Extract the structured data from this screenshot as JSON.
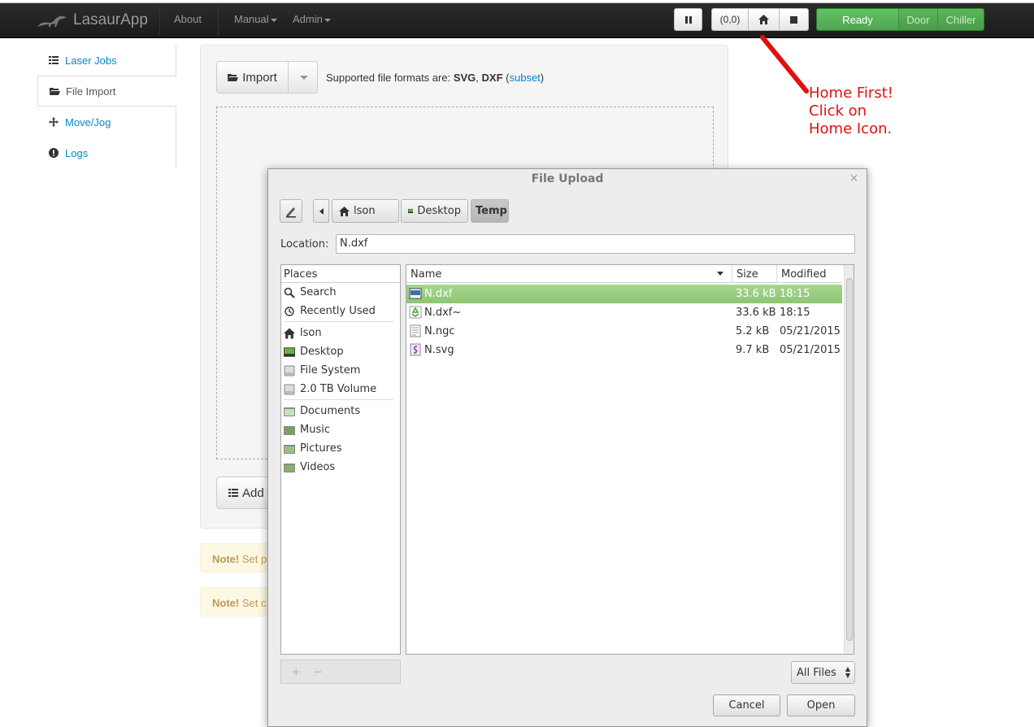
{
  "navbar": {
    "brand": "LasaurApp",
    "about": "About",
    "manual": "Manual",
    "admin": "Admin",
    "position_label": "(0,0)",
    "status_ready": "Ready",
    "status_door": "Door",
    "status_chiller": "Chiller"
  },
  "sidebar": {
    "items": [
      {
        "label": "Laser Jobs",
        "icon": "list-icon"
      },
      {
        "label": "File Import",
        "icon": "folder-open-icon"
      },
      {
        "label": "Move/Jog",
        "icon": "move-icon"
      },
      {
        "label": "Logs",
        "icon": "alert-circle-icon"
      }
    ]
  },
  "main": {
    "import_label": "Import",
    "supported_prefix": "Supported file formats are:",
    "fmt_svg": "SVG",
    "fmt_dxf": "DXF",
    "subset_link": "subset",
    "add_label": "Add",
    "note1_bold": "Note!",
    "note1_text": "Set p",
    "note2_bold": "Note!",
    "note2_text": "Set c"
  },
  "annotation": {
    "line1": "Home First!",
    "line2": "Click on",
    "line3": "Home Icon.",
    "color": "#e01010"
  },
  "dialog": {
    "title": "File Upload",
    "close": "×",
    "breadcrumbs": [
      "lson",
      "Desktop",
      "Temp"
    ],
    "location_label": "Location:",
    "location_value": "N.dxf",
    "places_header": "Places",
    "places": [
      {
        "label": "Search",
        "icon": "search-icon"
      },
      {
        "label": "Recently Used",
        "icon": "recent-icon"
      },
      {
        "label": "lson",
        "icon": "home-icon"
      },
      {
        "label": "Desktop",
        "icon": "desktop-icon"
      },
      {
        "label": "File System",
        "icon": "drive-icon"
      },
      {
        "label": "2.0 TB Volume",
        "icon": "drive-icon"
      },
      {
        "label": "Documents",
        "icon": "folder-icon"
      },
      {
        "label": "Music",
        "icon": "folder-music-icon"
      },
      {
        "label": "Pictures",
        "icon": "folder-pictures-icon"
      },
      {
        "label": "Videos",
        "icon": "folder-videos-icon"
      }
    ],
    "places_add": "+",
    "places_remove": "−",
    "columns": {
      "name": "Name",
      "size": "Size",
      "modified": "Modified"
    },
    "files": [
      {
        "name": "N.dxf",
        "size": "33.6 kB",
        "modified": "18:15",
        "icon": "image-file-icon",
        "selected": true
      },
      {
        "name": "N.dxf~",
        "size": "33.6 kB",
        "modified": "18:15",
        "icon": "backup-file-icon",
        "selected": false
      },
      {
        "name": "N.ngc",
        "size": "5.2 kB",
        "modified": "05/21/2015",
        "icon": "text-file-icon",
        "selected": false
      },
      {
        "name": "N.svg",
        "size": "9.7 kB",
        "modified": "05/21/2015",
        "icon": "svg-file-icon",
        "selected": false
      }
    ],
    "filter": "All Files",
    "cancel": "Cancel",
    "open": "Open"
  }
}
